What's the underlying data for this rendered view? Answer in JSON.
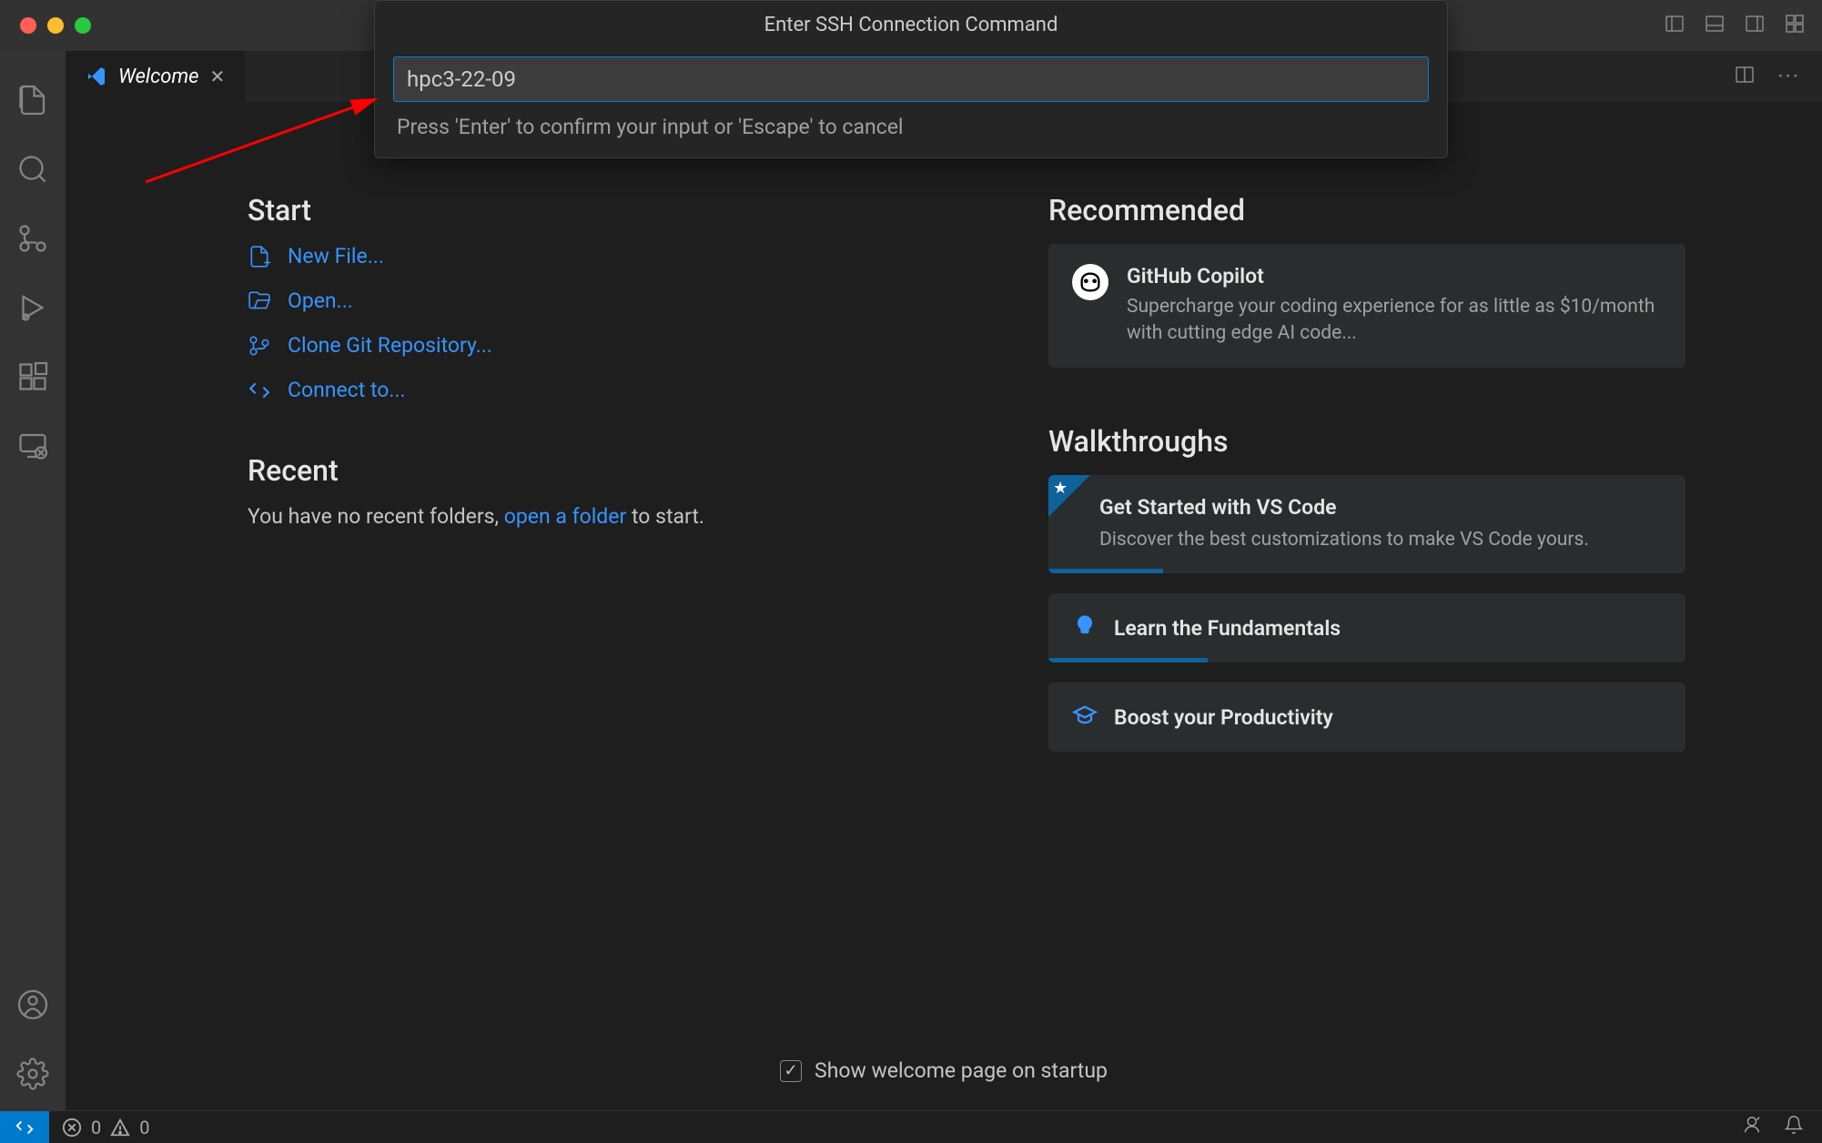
{
  "titleBar": {
    "quickInput": {
      "title": "Enter SSH Connection Command",
      "value": "hpc3-22-09",
      "hint": "Press 'Enter' to confirm your input or 'Escape' to cancel"
    }
  },
  "tabs": {
    "welcome": "Welcome"
  },
  "welcome": {
    "start": {
      "heading": "Start",
      "newFile": "New File...",
      "open": "Open...",
      "cloneGit": "Clone Git Repository...",
      "connectTo": "Connect to..."
    },
    "recent": {
      "heading": "Recent",
      "noRecent1": "You have no recent folders, ",
      "openFolderLink": "open a folder",
      "noRecent2": " to start."
    },
    "recommended": {
      "heading": "Recommended",
      "copilot": {
        "title": "GitHub Copilot",
        "desc": "Supercharge your coding experience for as little as $10/month with cutting edge AI code..."
      }
    },
    "walkthroughs": {
      "heading": "Walkthroughs",
      "getStarted": {
        "title": "Get Started with VS Code",
        "desc": "Discover the best customizations to make VS Code yours."
      },
      "fundamentals": "Learn the Fundamentals",
      "productivity": "Boost your Productivity"
    },
    "footer": {
      "showOnStartup": "Show welcome page on startup"
    }
  },
  "statusBar": {
    "errors": "0",
    "warnings": "0"
  }
}
